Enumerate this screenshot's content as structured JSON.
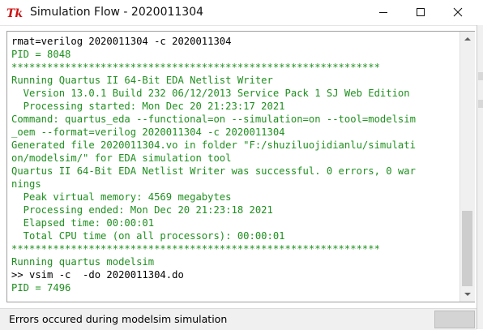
{
  "window": {
    "title": "Simulation Flow - 2020011304",
    "icon": "tk-feather-icon"
  },
  "titlebar_buttons": {
    "minimize": "minimize-icon",
    "maximize": "maximize-icon",
    "close": "close-icon"
  },
  "console": {
    "lines": [
      {
        "text": "rmat=verilog 2020011304 -c 2020011304",
        "color": "black"
      },
      {
        "text": "PID = 8048",
        "color": "green"
      },
      {
        "text": "**************************************************************",
        "color": "green"
      },
      {
        "text": "Running Quartus II 64-Bit EDA Netlist Writer",
        "color": "green"
      },
      {
        "text": "  Version 13.0.1 Build 232 06/12/2013 Service Pack 1 SJ Web Edition",
        "color": "green"
      },
      {
        "text": "  Processing started: Mon Dec 20 21:23:17 2021",
        "color": "green"
      },
      {
        "text": "Command: quartus_eda --functional=on --simulation=on --tool=modelsim",
        "color": "green"
      },
      {
        "text": "_oem --format=verilog 2020011304 -c 2020011304",
        "color": "green"
      },
      {
        "text": "Generated file 2020011304.vo in folder \"F:/shuziluojidianlu/simulati",
        "color": "green"
      },
      {
        "text": "on/modelsim/\" for EDA simulation tool",
        "color": "green"
      },
      {
        "text": "Quartus II 64-Bit EDA Netlist Writer was successful. 0 errors, 0 war",
        "color": "green"
      },
      {
        "text": "nings",
        "color": "green"
      },
      {
        "text": "  Peak virtual memory: 4569 megabytes",
        "color": "green"
      },
      {
        "text": "  Processing ended: Mon Dec 20 21:23:18 2021",
        "color": "green"
      },
      {
        "text": "  Elapsed time: 00:00:01",
        "color": "green"
      },
      {
        "text": "  Total CPU time (on all processors): 00:00:01",
        "color": "green"
      },
      {
        "text": "**************************************************************",
        "color": "green"
      },
      {
        "text": "Running quartus modelsim",
        "color": "green"
      },
      {
        "text": ">> vsim -c  -do 2020011304.do",
        "color": "black"
      },
      {
        "text": "PID = 7496",
        "color": "green"
      }
    ]
  },
  "colors": {
    "console_green": "#1f8f1f",
    "console_black": "#000000"
  },
  "status": {
    "message": "Errors occured during modelsim simulation"
  }
}
